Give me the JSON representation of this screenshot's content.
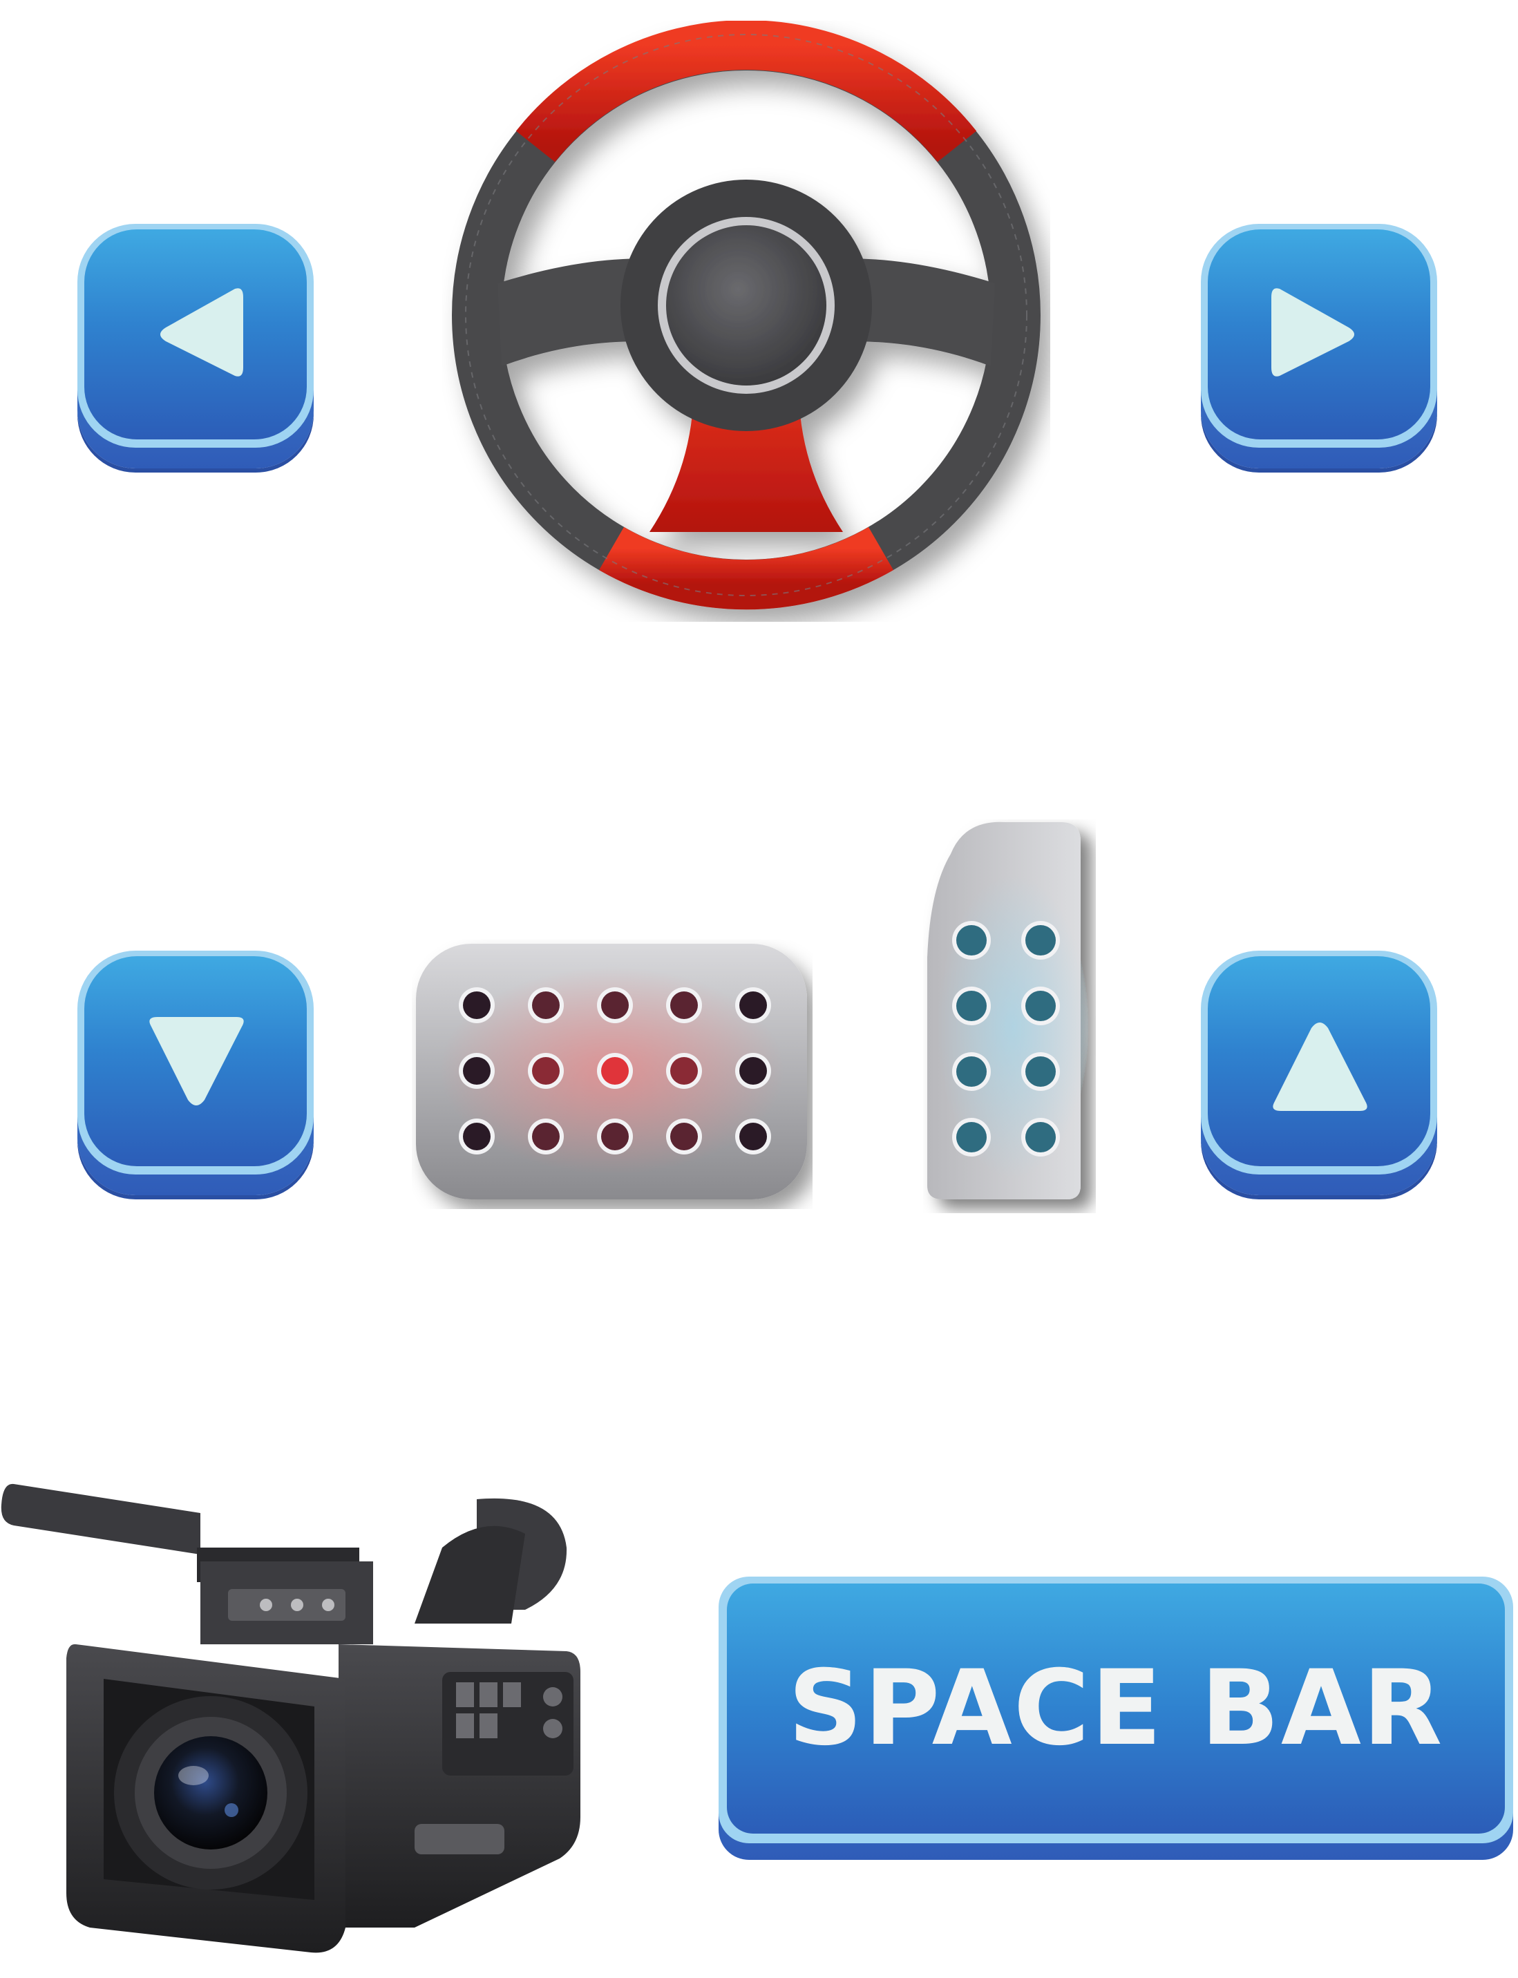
{
  "controls": {
    "space_bar_label": "SPACE BAR"
  },
  "icons": {
    "left": "arrow-left-icon",
    "right": "arrow-right-icon",
    "down": "arrow-down-icon",
    "up": "arrow-up-icon",
    "steering": "steering-wheel-icon",
    "brake": "brake-pedal-icon",
    "gas": "gas-pedal-icon",
    "camera": "video-camera-icon"
  },
  "colors": {
    "button_blue_top": "#3fa9e2",
    "button_blue_bottom": "#2c5db8",
    "button_rim": "#9fd4f2",
    "arrow_glyph": "#d9f0ee",
    "wheel_red": "#d8261a",
    "wheel_grip": "#4a4a4c"
  }
}
